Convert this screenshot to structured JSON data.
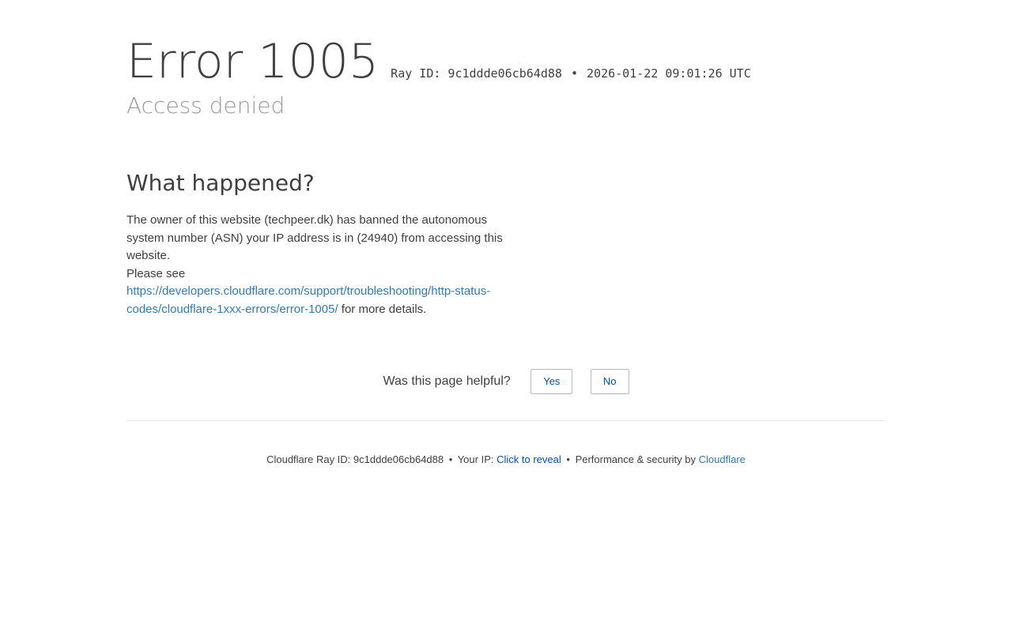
{
  "header": {
    "error_title": "Error 1005",
    "ray_label": "Ray ID: 9c1ddde06cb64d88",
    "ray_separator": "•",
    "timestamp": "2026-01-22 09:01:26 UTC",
    "subtitle": "Access denied"
  },
  "main": {
    "heading": "What happened?",
    "paragraph": "The owner of this website (techpeer.dk) has banned the autonomous system number (ASN) your IP address is in (24940) from accessing this website.",
    "please_see": "Please see",
    "link_text": "https://developers.cloudflare.com/support/troubleshooting/http-status-codes/cloudflare-1xxx-errors/error-1005/",
    "link_suffix": " for more details."
  },
  "feedback": {
    "question": "Was this page helpful?",
    "yes_label": "Yes",
    "no_label": "No"
  },
  "footer": {
    "ray_text": "Cloudflare Ray ID: 9c1ddde06cb64d88",
    "separator": "•",
    "ip_label": "Your IP:",
    "ip_reveal": "Click to reveal",
    "perf_text": "Performance & security by",
    "cloudflare_link": "Cloudflare"
  },
  "colors": {
    "text": "#404040",
    "subtitle": "#999999",
    "link": "#2f7bbf",
    "button_text": "#0051c3"
  }
}
